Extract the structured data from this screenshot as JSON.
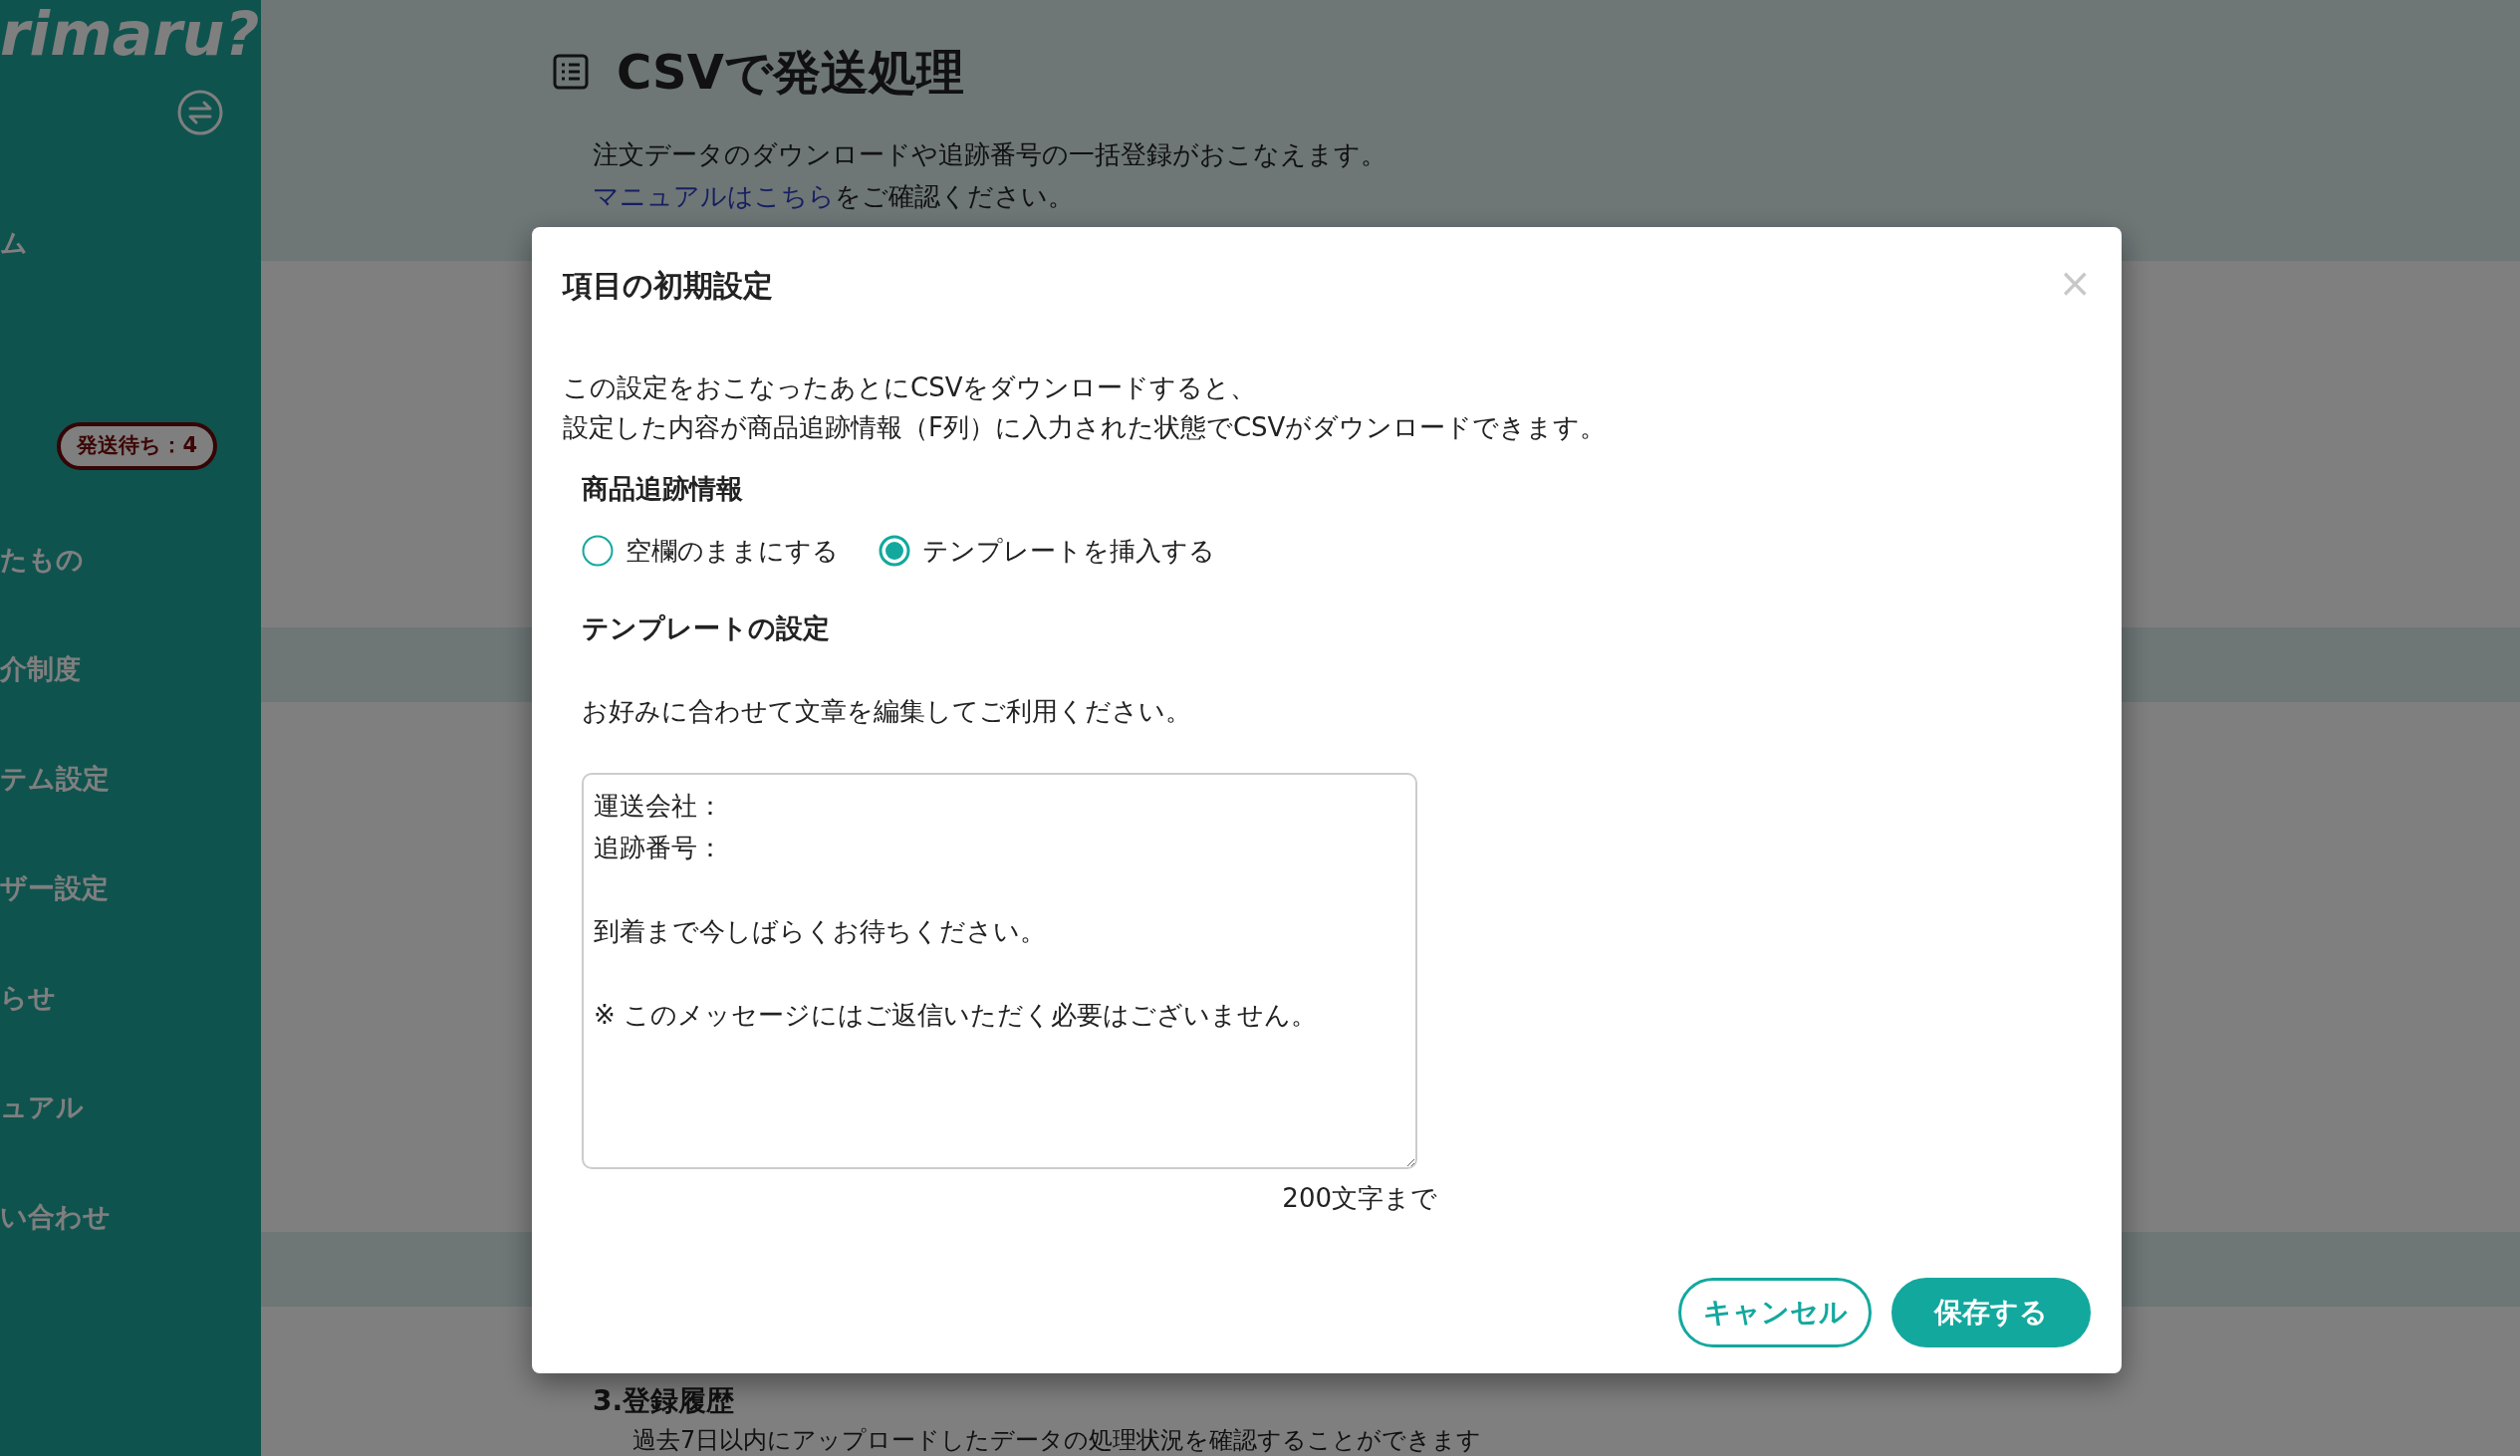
{
  "sidebar": {
    "logo": "rimaru?",
    "items": [
      {
        "label": "ム"
      },
      {
        "label": "たもの"
      },
      {
        "label": "介制度"
      },
      {
        "label": "テム設定"
      },
      {
        "label": "ザー設定"
      },
      {
        "label": "らせ"
      },
      {
        "label": "ュアル"
      },
      {
        "label": "い合わせ"
      }
    ],
    "badge": "発送待ち：4"
  },
  "page": {
    "title": "CSVで発送処理",
    "description": "注文データのダウンロードや追跡番号の一括登録がおこなえます。",
    "link": "マニュアルはこちら",
    "link_suffix": "をご確認ください。",
    "section_title": "3.登録履歴",
    "section_text": "過去7日以内にアップロードしたデータの処理状況を確認することができます"
  },
  "dialog": {
    "title": "項目の初期設定",
    "close": "×",
    "description": [
      "この設定をおこなったあとにCSVをダウンロードすると、",
      "設定した内容が商品追跡情報（F列）に入力された状態でCSVがダウンロードできます。"
    ],
    "tracking_label": "商品追跡情報",
    "options": [
      {
        "label": "空欄のままにする",
        "selected": false
      },
      {
        "label": "テンプレートを挿入する",
        "selected": true
      }
    ],
    "template_label": "テンプレートの設定",
    "template_hint": "お好みに合わせて文章を編集してご利用ください。",
    "template_value": [
      [
        "運送会社：",
        "追跡番号："
      ],
      [
        "到着まで今しばらくお待ちください。"
      ],
      [
        "※ このメッセージにはご返信いただく必要はございません。"
      ]
    ],
    "limit": "200文字まで",
    "buttons": [
      {
        "label": "キャンセル",
        "kind": "secondary"
      },
      {
        "label": "保存する",
        "kind": "primary"
      }
    ]
  }
}
